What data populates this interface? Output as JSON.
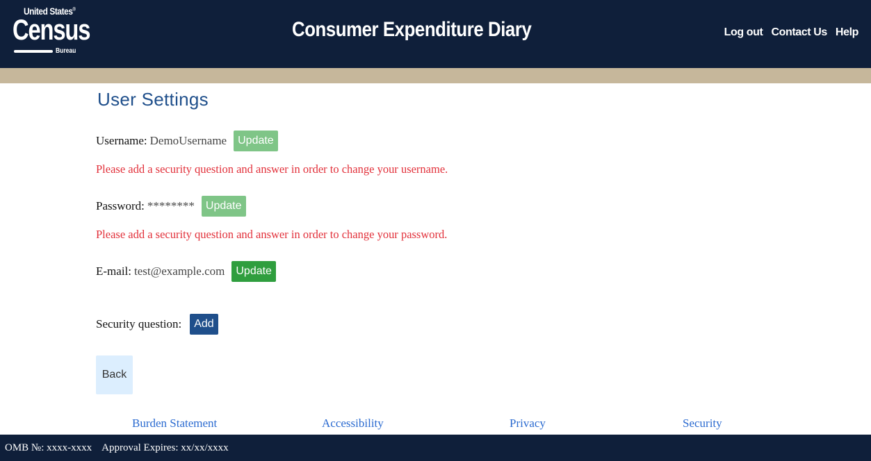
{
  "header": {
    "logo": {
      "line1": "United States",
      "trademark": "®",
      "wordmark": "Census",
      "line3": "Bureau"
    },
    "app_title": "Consumer Expenditure Diary",
    "nav": {
      "logout": "Log out",
      "contact": "Contact Us",
      "help": "Help"
    }
  },
  "main": {
    "title": "User Settings",
    "username": {
      "label": "Username:",
      "value": "DemoUsername",
      "button": "Update",
      "warning": "Please add a security question and answer in order to change your username."
    },
    "password": {
      "label": "Password:",
      "value": "********",
      "button": "Update",
      "warning": "Please add a security question and answer in order to change your password."
    },
    "email": {
      "label": "E-mail:",
      "value": "test@example.com",
      "button": "Update"
    },
    "security": {
      "label": "Security question:",
      "button": "Add"
    },
    "back_button": "Back"
  },
  "footer": {
    "links": {
      "burden": "Burden Statement",
      "accessibility": "Accessibility",
      "privacy": "Privacy",
      "security": "Security"
    },
    "omb": "OMB №: xxxx-xxxx",
    "approval": "Approval Expires: xx/xx/xxxx"
  },
  "colors": {
    "header_bg": "#0f1f3a",
    "tan_strip": "#c6b79b",
    "title_blue": "#1f4f8b",
    "warning_red": "#e2303a",
    "update_disabled": "#7fc587",
    "update_active": "#2f9e3e",
    "link_blue": "#2a6ad0"
  }
}
